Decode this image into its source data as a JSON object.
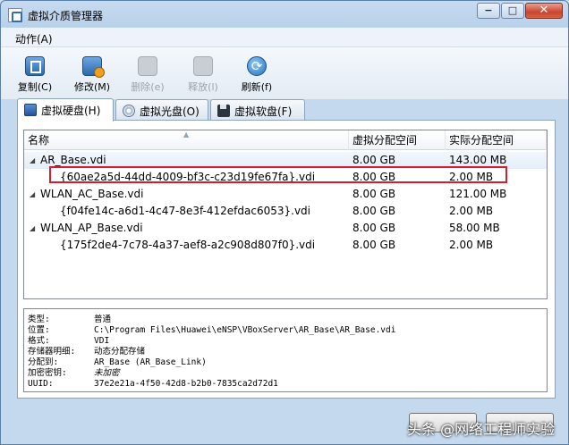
{
  "window": {
    "title": "虚拟介质管理器",
    "min": "−",
    "max": "□",
    "close": "✕"
  },
  "menu": {
    "action": "动作(A)"
  },
  "toolbar": {
    "copy": "复制(C)",
    "modify": "修改(M)",
    "remove": "删除(e)",
    "release": "释放(l)",
    "refresh": "刷新(f)"
  },
  "tabs": {
    "hdd": "虚拟硬盘(H)",
    "cd": "虚拟光盘(O)",
    "floppy": "虚拟软盘(F)"
  },
  "tree": {
    "columns": {
      "name": "名称",
      "virtual_size": "虚拟分配空间",
      "actual_size": "实际分配空间"
    },
    "rows": [
      {
        "name": "AR_Base.vdi",
        "virtual_size": "8.00 GB",
        "actual_size": "143.00 MB"
      },
      {
        "name": "{60ae2a5d-44dd-4009-bf3c-c23d19fe67fa}.vdi",
        "virtual_size": "8.00 GB",
        "actual_size": "2.00 MB"
      },
      {
        "name": "WLAN_AC_Base.vdi",
        "virtual_size": "8.00 GB",
        "actual_size": "121.00 MB"
      },
      {
        "name": "{f04fe14c-a6d1-4c47-8e3f-412efdac6053}.vdi",
        "virtual_size": "8.00 GB",
        "actual_size": "2.00 MB"
      },
      {
        "name": "WLAN_AP_Base.vdi",
        "virtual_size": "8.00 GB",
        "actual_size": "58.00 MB"
      },
      {
        "name": "{175f2de4-7c78-4a37-aef8-a2c908d807f0}.vdi",
        "virtual_size": "8.00 GB",
        "actual_size": "2.00 MB"
      }
    ]
  },
  "details": {
    "type_label": "类型:",
    "type_value": "普通",
    "location_label": "位置:",
    "location_value": "C:\\Program  Files\\Huawei\\eNSP\\VBoxServer\\AR_Base\\AR_Base.vdi",
    "format_label": "格式:",
    "format_value": "VDI",
    "storage_label": "存储器明细:",
    "storage_value": "动态分配存储",
    "attached_label": "分配到:",
    "attached_value": "AR_Base  (AR_Base_Link)",
    "encryption_label": "加密密钥:",
    "encryption_value": "未加密",
    "uuid_label": "UUID:",
    "uuid_value": "37e2e21a-4f50-42d8-b2b0-7835ca2d72d1"
  },
  "footer": {
    "watermark": "头条 @网络工程师实验"
  },
  "colors": {
    "highlight_box": "#d0202a",
    "title_bar": "#c7dbf0"
  }
}
